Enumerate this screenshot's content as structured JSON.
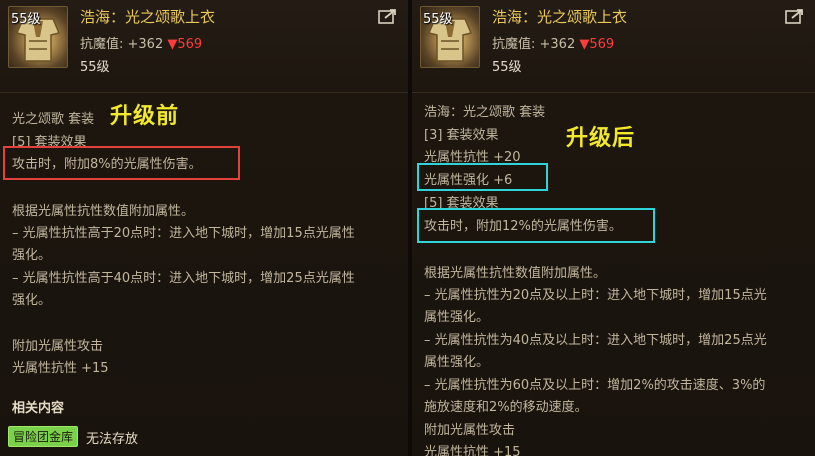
{
  "left": {
    "level_badge": "55级",
    "item_name": "浩海：光之颂歌上衣",
    "stat_label": "抗魔值: +362",
    "stat_down": "▼569",
    "level": "55级",
    "tag": "升级前",
    "set_name": "光之颂歌  套装",
    "set_effect": "[5] 套装效果",
    "effect_line": "攻击时，附加8%的光属性伤害。",
    "desc_lines": [
      "根据光属性抗性数值附加属性。",
      "– 光属性抗性高于20点时：进入地下城时，增加15点光属性",
      "强化。",
      "– 光属性抗性高于40点时：进入地下城时，增加25点光属性",
      "强化。"
    ],
    "extra_title": "附加光属性攻击",
    "extra_value": "光属性抗性 +15",
    "related_title": "相关内容",
    "related_tag": "冒险团金库",
    "related_note": "无法存放"
  },
  "right": {
    "level_badge": "55级",
    "item_name": "浩海：光之颂歌上衣",
    "stat_label": "抗魔值: +362",
    "stat_down": "▼569",
    "level": "55级",
    "tag": "升级后",
    "set_name": "浩海：光之颂歌  套装",
    "set3_effect": "[3] 套装效果",
    "set3_line1": "光属性抗性 +20",
    "set3_line2": "光属性强化 +6",
    "set5_effect": "[5] 套装效果",
    "effect_line": "攻击时，附加12%的光属性伤害。",
    "desc_lines": [
      "根据光属性抗性数值附加属性。",
      "– 光属性抗性为20点及以上时：进入地下城时，增加15点光",
      "属性强化。",
      "– 光属性抗性为40点及以上时：进入地下城时，增加25点光",
      "属性强化。",
      "– 光属性抗性为60点及以上时：增加2%的攻击速度、3%的",
      "施放速度和2%的移动速度。"
    ],
    "extra_title": "附加光属性攻击",
    "extra_value": "光属性抗性 +15"
  },
  "colors": {
    "highlight_red": "#e2423b",
    "highlight_cyan": "#2fd4db",
    "item_name": "#e9c85a",
    "tag_yellow": "#f3e92b"
  },
  "icons": [
    "armor-icon",
    "share-icon"
  ]
}
